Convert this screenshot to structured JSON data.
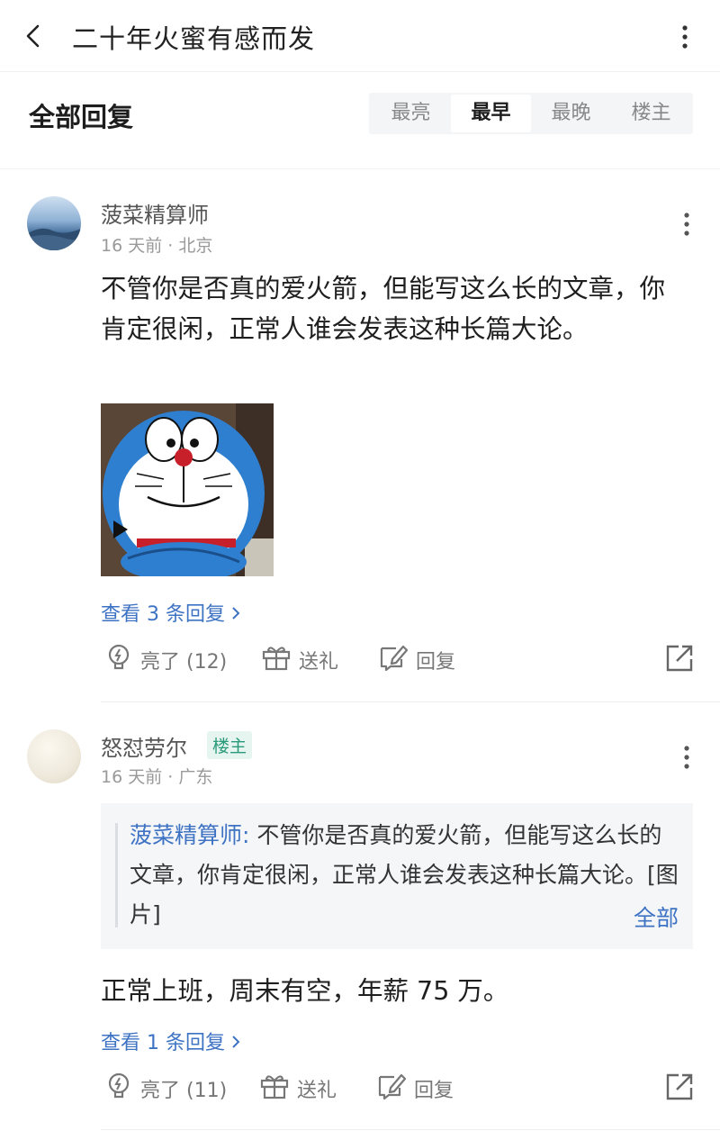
{
  "header": {
    "title": "二十年火蜜有感而发"
  },
  "replies_section": {
    "title": "全部回复",
    "sort_tabs": [
      "最亮",
      "最早",
      "最晚",
      "楼主"
    ],
    "active_sort": "最早"
  },
  "comments": [
    {
      "username": "菠菜精算师",
      "meta": "16 天前 · 北京",
      "text": "不管你是否真的爱火箭，但能写这么长的文章，你肯定很闲，正常人谁会发表这种长篇大论。",
      "view_replies": "查看 3 条回复",
      "actions": {
        "like": "亮了 (12)",
        "gift": "送礼",
        "reply": "回复"
      }
    },
    {
      "username": "怒怼劳尔",
      "badge": "楼主",
      "meta": "16 天前 · 广东",
      "quote": {
        "author": "菠菜精算师:",
        "text": " 不管你是否真的爱火箭，但能写这么长的文章，你肯定很闲，正常人谁会发表这种长篇大论。[图片]",
        "expand": "全部"
      },
      "text": "正常上班，周末有空，年薪 75 万。",
      "view_replies": "查看 1 条回复",
      "actions": {
        "like": "亮了 (11)",
        "gift": "送礼",
        "reply": "回复"
      }
    }
  ],
  "colors": {
    "link": "#3e73c4",
    "badge_text": "#2a9a7a",
    "badge_bg": "#e6f5ef",
    "sort_bg": "#f4f5f7"
  },
  "icons": [
    "back-arrow-icon",
    "more-vertical-icon",
    "like-bulb-icon",
    "gift-icon",
    "reply-pen-icon",
    "share-icon",
    "chevron-right-icon"
  ]
}
